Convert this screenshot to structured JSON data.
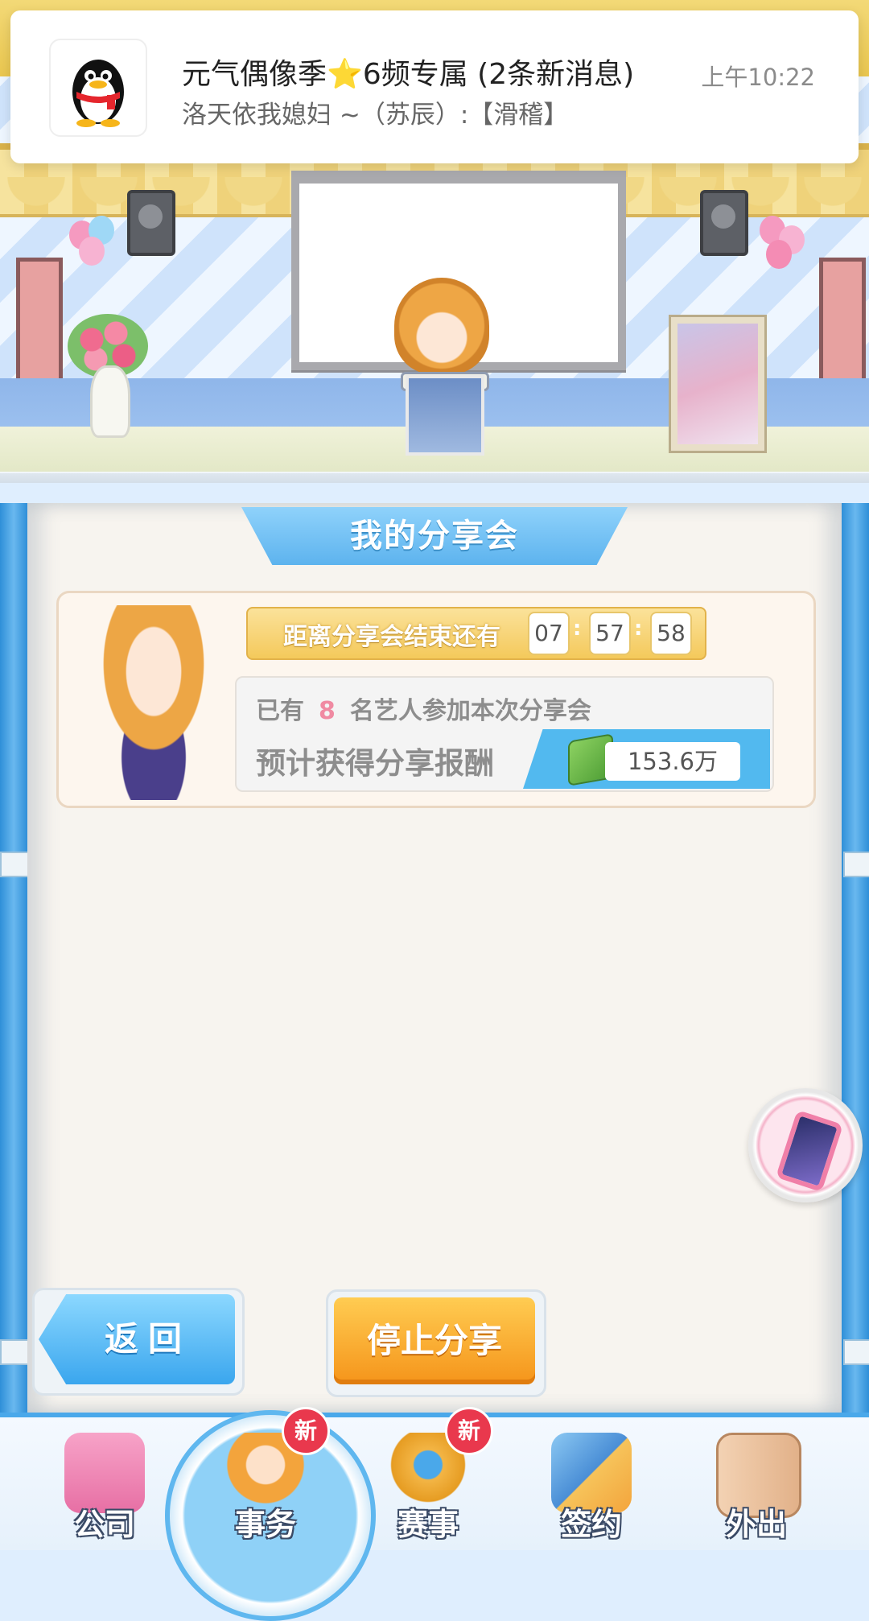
{
  "notification": {
    "title": "元气偶像季⭐6频专属 (2条新消息)",
    "body": "洛天依我媳妇 ~（苏辰）:【滑稽】",
    "time": "上午10:22",
    "app_icon": "qq-penguin-icon"
  },
  "panel": {
    "title": "我的分享会",
    "timer_label": "距离分享会结束还有",
    "timer": {
      "hours": "07",
      "minutes": "57",
      "seconds": "58"
    },
    "participants_prefix": "已有",
    "participants_count": "8",
    "participants_suffix": "名艺人参加本次分享会",
    "reward_label": "预计获得分享报酬",
    "reward_value": "153.6万"
  },
  "buttons": {
    "back": "返回",
    "stop": "停止分享"
  },
  "nav": {
    "items": [
      {
        "label": "公司",
        "icon": "company-building-icon"
      },
      {
        "label": "事务",
        "icon": "manager-avatar-icon",
        "badge": "新",
        "active": true
      },
      {
        "label": "赛事",
        "icon": "trophy-icon",
        "badge": "新"
      },
      {
        "label": "签约",
        "icon": "contract-hand-icon"
      },
      {
        "label": "外出",
        "icon": "door-exit-icon"
      }
    ]
  },
  "colors": {
    "accent_blue": "#4aa8ea",
    "stop_orange": "#f5941a",
    "badge_red": "#e9384d",
    "timer_yellow": "#f4c95b"
  }
}
